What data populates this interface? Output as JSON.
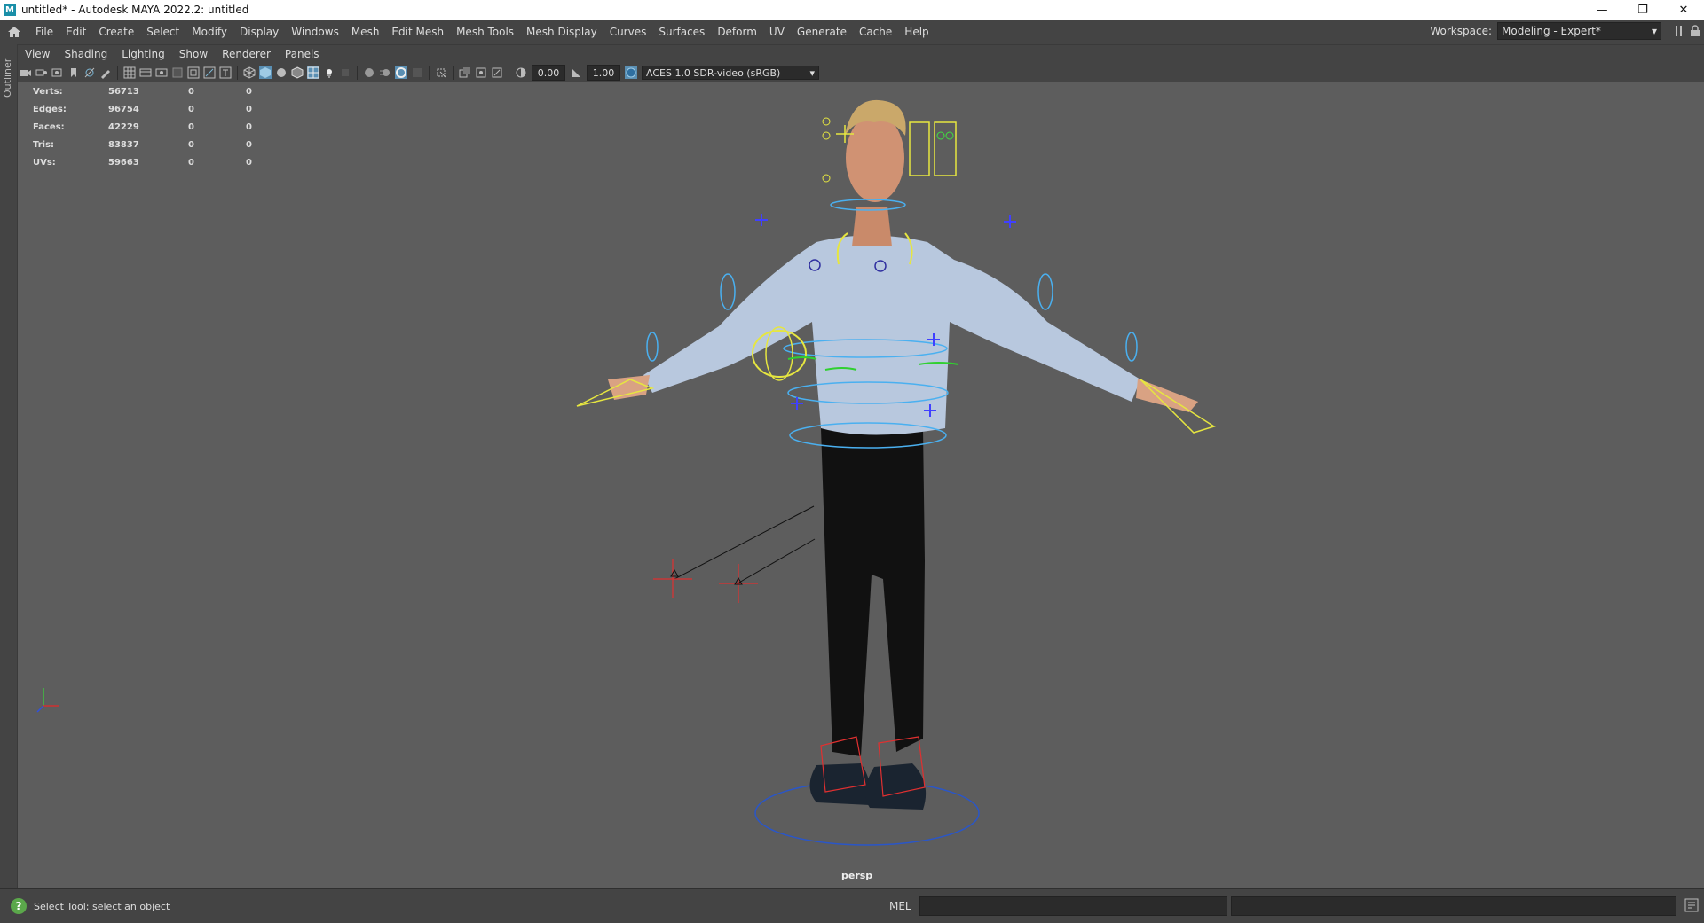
{
  "window": {
    "title": "untitled* - Autodesk MAYA 2022.2: untitled",
    "app_icon": "M",
    "controls": [
      "minimize-icon",
      "maximize-icon",
      "close-icon"
    ]
  },
  "menubar": {
    "items": [
      "File",
      "Edit",
      "Create",
      "Select",
      "Modify",
      "Display",
      "Windows",
      "Mesh",
      "Edit Mesh",
      "Mesh Tools",
      "Mesh Display",
      "Curves",
      "Surfaces",
      "Deform",
      "UV",
      "Generate",
      "Cache",
      "Help"
    ],
    "workspace_label": "Workspace:",
    "workspace_value": "Modeling - Expert*"
  },
  "outliner_tab": "Outliner",
  "panel_menu": [
    "View",
    "Shading",
    "Lighting",
    "Show",
    "Renderer",
    "Panels"
  ],
  "toolbar": {
    "exposure": "0.00",
    "gamma": "1.00",
    "color_space": "ACES 1.0 SDR-video (sRGB)"
  },
  "hud": {
    "rows": [
      {
        "label": "Verts:",
        "value": "56713",
        "sel": "0",
        "comp": "0"
      },
      {
        "label": "Edges:",
        "value": "96754",
        "sel": "0",
        "comp": "0"
      },
      {
        "label": "Faces:",
        "value": "42229",
        "sel": "0",
        "comp": "0"
      },
      {
        "label": "Tris:",
        "value": "83837",
        "sel": "0",
        "comp": "0"
      },
      {
        "label": "UVs:",
        "value": "59663",
        "sel": "0",
        "comp": "0"
      }
    ]
  },
  "camera_label": "persp",
  "statusbar": {
    "help_text": "Select Tool: select an object",
    "mel_label": "MEL"
  }
}
